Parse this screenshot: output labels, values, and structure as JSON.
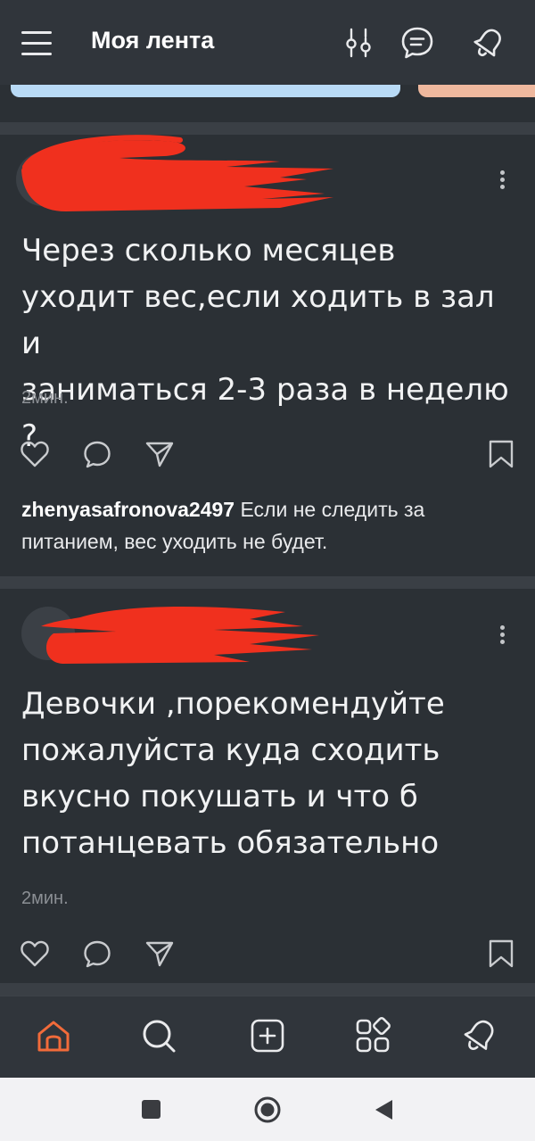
{
  "header": {
    "title": "Моя лента",
    "icons": [
      "menu-icon",
      "filter-icon",
      "chat-icon",
      "bell-icon"
    ]
  },
  "stories": {
    "colors": [
      "#b8daf6",
      "#efb89e"
    ]
  },
  "posts": [
    {
      "text_lines": [
        "Через сколько месяцев",
        "уходит вес,если ходить в зал и",
        "заниматься 2-3 раза в неделю ?"
      ],
      "time": "2мин.",
      "comment": {
        "author": "zhenyasafronova2497",
        "text": "Если не следить за питанием, вес уходить не будет."
      }
    },
    {
      "text_lines": [
        "Девочки ,порекомендуйте",
        "пожалуйста куда сходить",
        "вкусно покушать и что б",
        "потанцевать обязательно"
      ],
      "time": "2мин."
    }
  ],
  "colors": {
    "background": "#2b3035",
    "accent_home": "#f26b3a",
    "redaction": "#f0301e"
  },
  "bottom_nav": [
    "home-icon",
    "search-icon",
    "add-icon",
    "apps-icon",
    "profile-icon"
  ],
  "system_nav": [
    "recents-button",
    "home-button",
    "back-button"
  ]
}
